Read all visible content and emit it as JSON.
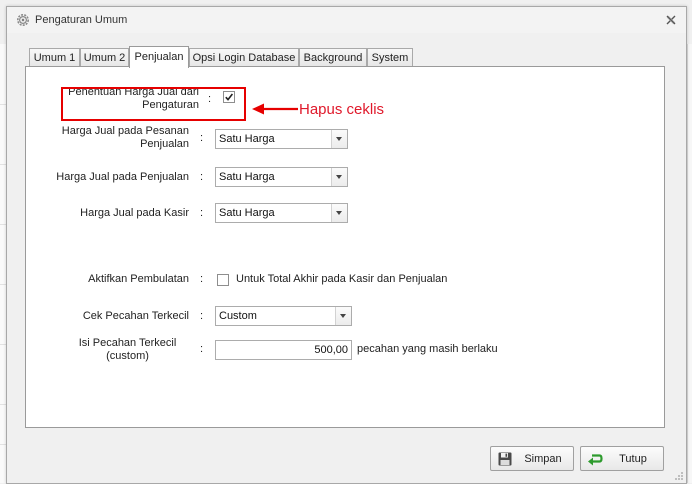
{
  "window": {
    "title": "Pengaturan Umum",
    "settings_icon": "gear-icon",
    "close_icon": "close-icon"
  },
  "tabs": [
    {
      "label": "Umum 1",
      "active": false
    },
    {
      "label": "Umum 2",
      "active": false
    },
    {
      "label": "Penjualan",
      "active": true
    },
    {
      "label": "Opsi Login Database",
      "active": false
    },
    {
      "label": "Background",
      "active": false
    },
    {
      "label": "System",
      "active": false
    }
  ],
  "form": {
    "colon": ":",
    "harga_dari_pengaturan": {
      "label_line1": "Penentuan Harga Jual dari",
      "label_line2": "Pengaturan",
      "checked": true
    },
    "harga_pesanan_penjualan": {
      "label_line1": "Harga Jual pada Pesanan",
      "label_line2": "Penjualan",
      "value": "Satu Harga"
    },
    "harga_penjualan": {
      "label": "Harga Jual pada Penjualan",
      "value": "Satu Harga"
    },
    "harga_kasir": {
      "label": "Harga Jual pada Kasir",
      "value": "Satu Harga"
    },
    "aktifkan_pembulatan": {
      "label": "Aktifkan Pembulatan",
      "checkbox_label": "Untuk Total Akhir pada Kasir dan Penjualan",
      "checked": false
    },
    "cek_pecahan": {
      "label": "Cek Pecahan Terkecil",
      "value": "Custom"
    },
    "isi_pecahan": {
      "label_line1": "Isi Pecahan Terkecil",
      "label_line2": "(custom)",
      "value": "500,00",
      "suffix": "pecahan yang masih berlaku"
    }
  },
  "annotation": {
    "text": "Hapus ceklis",
    "color": "#e60000"
  },
  "buttons": {
    "save": {
      "label": "Simpan",
      "icon": "floppy-disk-icon"
    },
    "close": {
      "label": "Tutup",
      "icon": "return-arrow-icon"
    }
  },
  "colors": {
    "accent_red": "#e60000",
    "close_green": "#2e9b2e"
  }
}
